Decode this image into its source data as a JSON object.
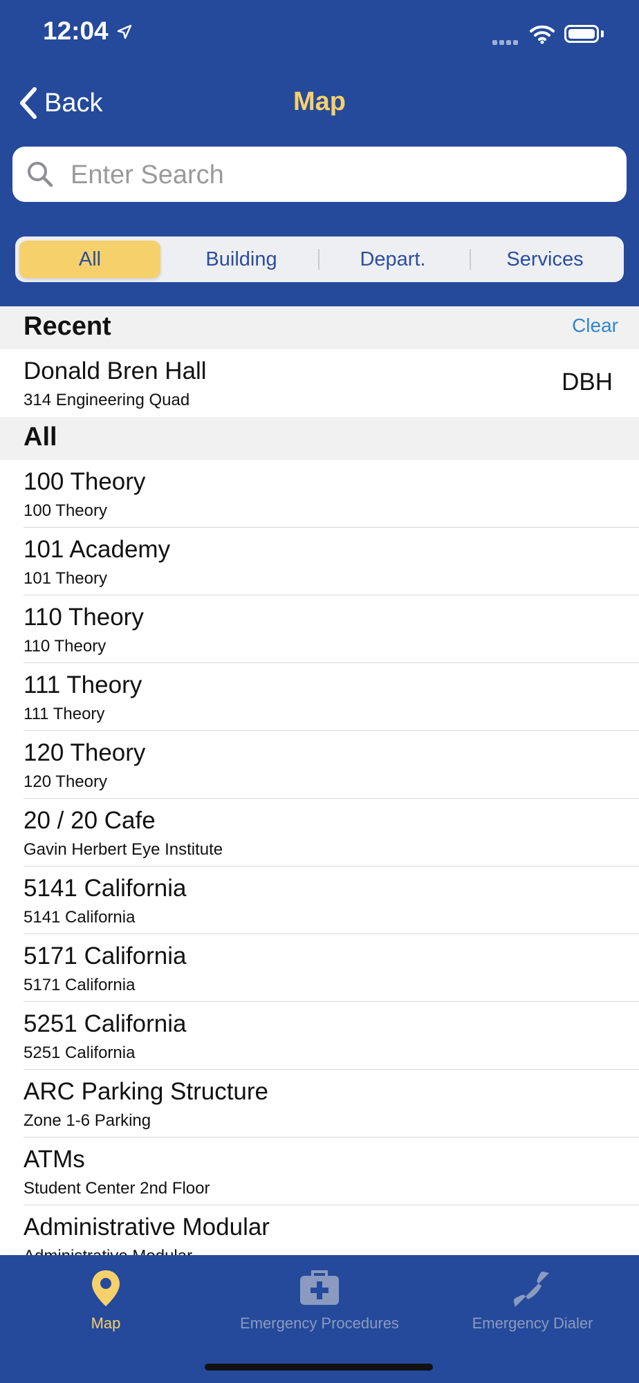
{
  "status_bar": {
    "time": "12:04"
  },
  "nav": {
    "back_label": "Back",
    "title": "Map"
  },
  "search": {
    "placeholder": "Enter Search",
    "value": ""
  },
  "filters": {
    "selected": "All",
    "options": [
      "All",
      "Building",
      "Depart.",
      "Services"
    ]
  },
  "recent": {
    "header": "Recent",
    "clear_label": "Clear",
    "items": [
      {
        "title": "Donald Bren Hall",
        "subtitle": "314 Engineering Quad",
        "code": "DBH"
      }
    ]
  },
  "all": {
    "header": "All",
    "items": [
      {
        "title": "100 Theory",
        "subtitle": "100 Theory"
      },
      {
        "title": "101 Academy",
        "subtitle": "101 Theory"
      },
      {
        "title": "110 Theory",
        "subtitle": "110 Theory"
      },
      {
        "title": "111 Theory",
        "subtitle": "111 Theory"
      },
      {
        "title": "120 Theory",
        "subtitle": "120 Theory"
      },
      {
        "title": "20 / 20 Cafe",
        "subtitle": "Gavin Herbert Eye Institute"
      },
      {
        "title": "5141 California",
        "subtitle": "5141 California"
      },
      {
        "title": "5171 California",
        "subtitle": "5171 California"
      },
      {
        "title": "5251 California",
        "subtitle": "5251 California"
      },
      {
        "title": "ARC Parking Structure",
        "subtitle": "Zone 1-6 Parking"
      },
      {
        "title": "ATMs",
        "subtitle": "Student Center 2nd Floor"
      },
      {
        "title": "Administrative Modular",
        "subtitle": "Administrative Modular"
      }
    ]
  },
  "tabbar": {
    "active": "Map",
    "tabs": [
      {
        "label": "Map",
        "icon": "map-pin-icon"
      },
      {
        "label": "Emergency Procedures",
        "icon": "first-aid-kit-icon"
      },
      {
        "label": "Emergency Dialer",
        "icon": "phone-icon"
      }
    ]
  },
  "colors": {
    "brand_blue": "#254a9b",
    "accent_yellow": "#f6d06b",
    "link_blue": "#2f86cc",
    "inactive_tab": "#8a9bbf"
  }
}
